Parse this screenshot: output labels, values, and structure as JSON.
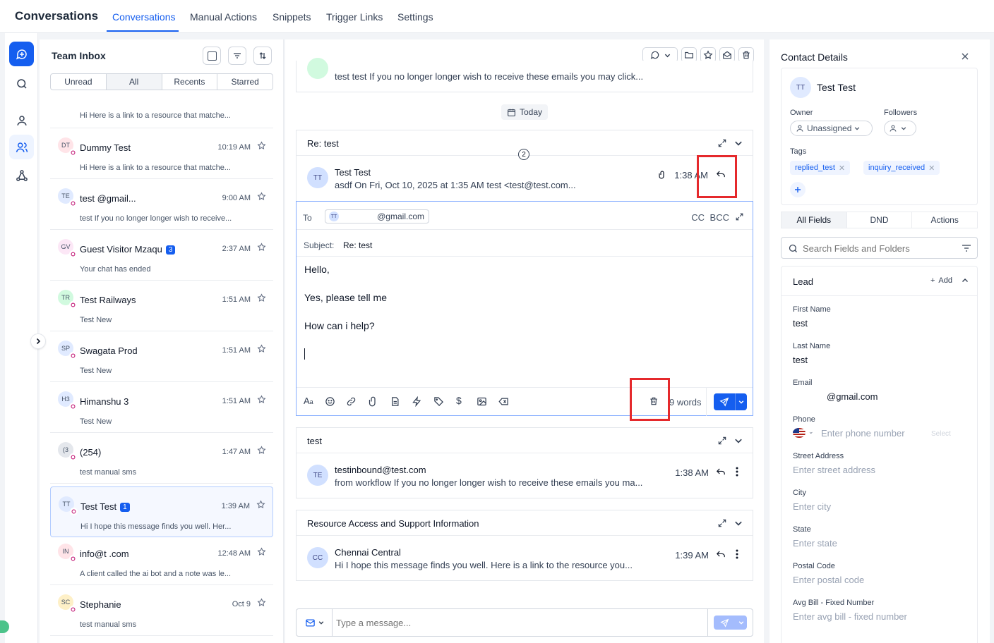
{
  "topnav": {
    "title": "Conversations",
    "tabs": [
      {
        "label": "Conversations",
        "active": true
      },
      {
        "label": "Manual Actions",
        "active": false
      },
      {
        "label": "Snippets",
        "active": false
      },
      {
        "label": "Trigger Links",
        "active": false
      },
      {
        "label": "Settings",
        "active": false
      }
    ]
  },
  "inbox": {
    "title": "Team Inbox",
    "filters": [
      "Unread",
      "All",
      "Recents",
      "Starred"
    ],
    "active_filter": "All",
    "partial_preview": "Hi Here is a link to a resource that matche...",
    "conversations": [
      {
        "initials": "DT",
        "name": "Dummy Test",
        "time": "10:19 AM",
        "preview": "Hi Here is a link to a resource that matche...",
        "badge": "",
        "color": "#ffe4e8"
      },
      {
        "initials": "TE",
        "name": "test                    @gmail...",
        "time": "9:00 AM",
        "preview": "test If you no longer longer wish to receive...",
        "badge": "",
        "color": "#e0eaff"
      },
      {
        "initials": "GV",
        "name": "Guest Visitor Mzaqu",
        "time": "2:37 AM",
        "preview": "Your chat has ended",
        "badge": "3",
        "color": "#fce7f6"
      },
      {
        "initials": "TR",
        "name": "Test Railways",
        "time": "1:51 AM",
        "preview": "Test New",
        "badge": "",
        "color": "#d1fadf"
      },
      {
        "initials": "SP",
        "name": "Swagata Prod",
        "time": "1:51 AM",
        "preview": "Test New",
        "badge": "",
        "color": "#e0eaff"
      },
      {
        "initials": "H3",
        "name": "Himanshu 3",
        "time": "1:51 AM",
        "preview": "Test New",
        "badge": "",
        "color": "#e0eaff"
      },
      {
        "initials": "(3",
        "name": "(254)",
        "time": "1:47 AM",
        "preview": "test manual sms",
        "badge": "",
        "color": "#e4e7ec"
      },
      {
        "initials": "TT",
        "name": "Test Test",
        "time": "1:39 AM",
        "preview": "Hi I hope this message finds you well. Her...",
        "badge": "1",
        "color": "#e0eaff",
        "selected": true
      },
      {
        "initials": "IN",
        "name": "info@t            .com",
        "time": "12:48 AM",
        "preview": "A client called the ai bot and a note was le...",
        "badge": "",
        "color": "#ffe4e8"
      },
      {
        "initials": "SC",
        "name": "Stephanie",
        "time": "Oct 9",
        "preview": "test manual sms",
        "badge": "",
        "color": "#fef0c7"
      }
    ]
  },
  "thread": {
    "top_preview": "test test If you no longer longer wish to receive these emails you may click...",
    "date_chip": "Today",
    "annotation_number": "2",
    "email1": {
      "subject": "Re: test",
      "initials": "TT",
      "from": "Test Test",
      "preview": "asdf On Fri, Oct 10, 2025 at 1:35 AM test <test@test.com...",
      "time": "1:38 AM"
    },
    "compose": {
      "to_label": "To",
      "to_chip_initials": "TT",
      "to_value": "@gmail.com",
      "cc": "CC",
      "bcc": "BCC",
      "subject_label": "Subject:",
      "subject_value": "Re: test",
      "body": [
        "Hello,",
        "Yes, please tell me",
        "How  can i help?"
      ],
      "word_count": "9 words"
    },
    "email2": {
      "subject": "test",
      "initials": "TE",
      "from": "testinbound@test.com",
      "preview": "from workflow If you no longer longer wish to receive these emails you ma...",
      "time": "1:38 AM"
    },
    "email3": {
      "subject": "Resource Access and Support Information",
      "initials": "CC",
      "from": "Chennai Central",
      "preview": "Hi I hope this message finds you well. Here is a link to the resource you...",
      "time": "1:39 AM"
    },
    "reply_placeholder": "Type a message..."
  },
  "contact": {
    "title": "Contact Details",
    "initials": "TT",
    "name": "Test Test",
    "owner_label": "Owner",
    "owner_value": "Unassigned",
    "followers_label": "Followers",
    "tags_label": "Tags",
    "tags": [
      "replied_test",
      "inquiry_received"
    ],
    "tabs": [
      "All Fields",
      "DND",
      "Actions"
    ],
    "search_placeholder": "Search Fields and Folders",
    "section": "Lead",
    "add_label": "Add",
    "fields": [
      {
        "label": "First Name",
        "value": "test",
        "placeholder": ""
      },
      {
        "label": "Last Name",
        "value": "test",
        "placeholder": ""
      },
      {
        "label": "Email",
        "value": "@gmail.com",
        "placeholder": ""
      },
      {
        "label": "Phone",
        "value": "",
        "placeholder": "Enter phone number"
      },
      {
        "label": "Street Address",
        "value": "",
        "placeholder": "Enter street address"
      },
      {
        "label": "City",
        "value": "",
        "placeholder": "Enter city"
      },
      {
        "label": "State",
        "value": "",
        "placeholder": "Enter state"
      },
      {
        "label": "Postal Code",
        "value": "",
        "placeholder": "Enter postal code"
      },
      {
        "label": "Avg Bill - Fixed Number",
        "value": "",
        "placeholder": "Enter avg bill - fixed number"
      }
    ],
    "phone_select": "Select"
  },
  "colors": {
    "accent": "#155eef",
    "highlight": "#e5292c"
  }
}
